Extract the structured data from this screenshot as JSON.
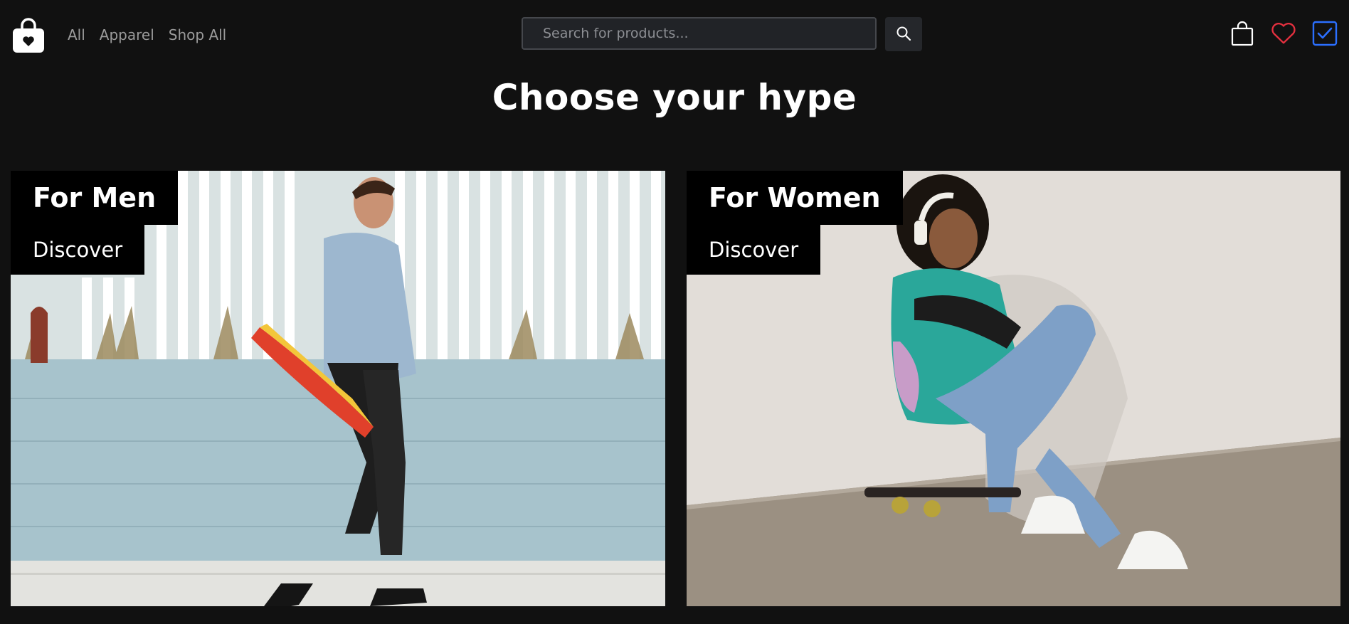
{
  "header": {
    "logo_icon": "shopping-bag-heart-icon",
    "nav": [
      {
        "label": "All"
      },
      {
        "label": "Apparel"
      },
      {
        "label": "Shop All"
      }
    ],
    "search": {
      "placeholder": "Search for products...",
      "value": ""
    },
    "search_button_icon": "search-icon",
    "icons": [
      "cart-icon",
      "heart-icon",
      "checkbox-icon"
    ]
  },
  "main": {
    "title": "Choose your hype",
    "cards": [
      {
        "title": "For Men",
        "cta": "Discover",
        "image": "man-with-skateboard-photo"
      },
      {
        "title": "For Women",
        "cta": "Discover",
        "image": "woman-on-skateboard-photo"
      }
    ]
  },
  "colors": {
    "background": "#111111",
    "text": "#ffffff",
    "nav_text": "#9a9a9a",
    "heart": "#e5303f",
    "check": "#2b6fff"
  }
}
